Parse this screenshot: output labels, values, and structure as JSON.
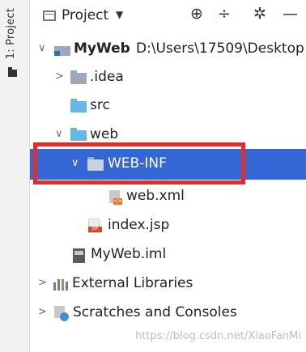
{
  "sidebar": {
    "tab_label": "1: Project",
    "tab_icon": "folder-icon"
  },
  "header": {
    "title": "Project",
    "icons": [
      "project-view-icon",
      "dropdown-caret-icon",
      "locate-target-icon",
      "collapse-all-icon",
      "settings-gear-icon",
      "minimize-icon"
    ]
  },
  "tree": {
    "root_name": "MyWeb",
    "root_path": "D:\\Users\\17509\\Desktop",
    "idea": ".idea",
    "src": "src",
    "web": "web",
    "web_inf": "WEB-INF",
    "web_xml": "web.xml",
    "index_jsp": "index.jsp",
    "iml": "MyWeb.iml",
    "external_libraries": "External Libraries",
    "scratches": "Scratches and Consoles"
  },
  "colors": {
    "selection": "#3566d6",
    "highlight_box": "#e22b2b",
    "source_folder": "#66b6e8"
  },
  "watermark": "https://blog.csdn.net/XiaoFanMi"
}
